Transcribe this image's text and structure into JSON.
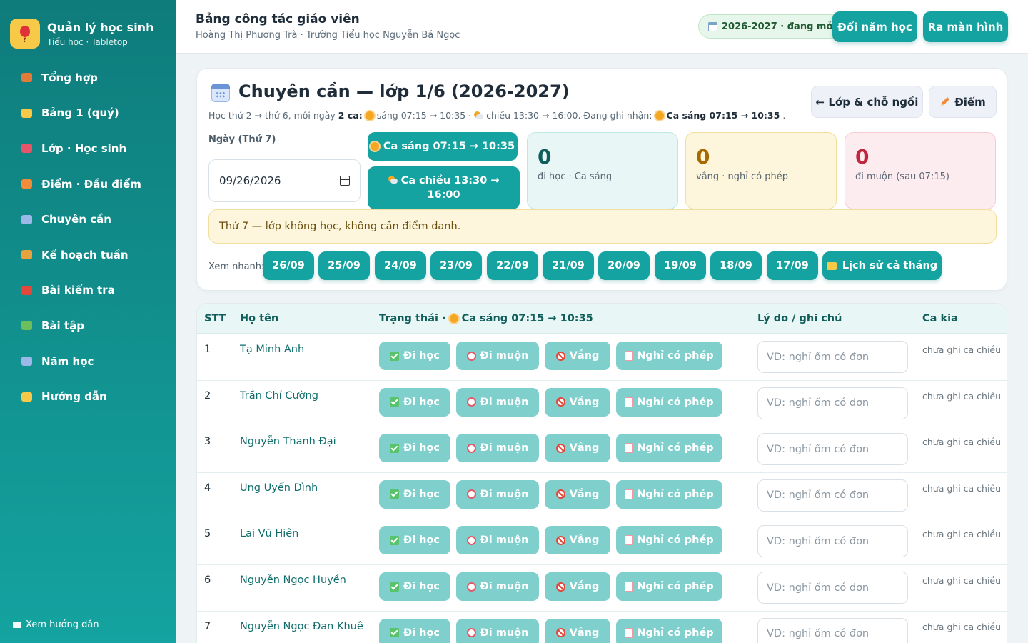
{
  "brand": {
    "title": "Quản lý học sinh",
    "subtitle": "Tiểu học · Tabletop"
  },
  "nav": [
    {
      "label": "Tổng hợp",
      "icon": "house-icon",
      "color": "#e07b39"
    },
    {
      "label": "Bảng 1 (quý)",
      "icon": "folder-icon",
      "color": "#f7c948"
    },
    {
      "label": "Lớp · Học sinh",
      "icon": "backpack-icon",
      "color": "#e8546a"
    },
    {
      "label": "Điểm · Đầu điểm",
      "icon": "pencil-icon",
      "color": "#f08c3a"
    },
    {
      "label": "Chuyên cần",
      "icon": "calendar-icon",
      "color": "#9bb8e8"
    },
    {
      "label": "Kế hoạch tuần",
      "icon": "compass-icon",
      "color": "#e6a23c"
    },
    {
      "label": "Bài kiểm tra",
      "icon": "target-icon",
      "color": "#e0483b"
    },
    {
      "label": "Bài tập",
      "icon": "books-icon",
      "color": "#6cbf5b"
    },
    {
      "label": "Năm học",
      "icon": "calendar-icon",
      "color": "#9bb8e8"
    },
    {
      "label": "Hướng dẫn",
      "icon": "bulb-icon",
      "color": "#f7c948"
    }
  ],
  "sidebar_footer": "Xem hướng dẫn",
  "header": {
    "title": "Bảng công tác giáo viên",
    "subtitle": "Hoàng Thị Phương Trà · Trường Tiểu học Nguyễn Bá Ngọc",
    "year_status": "2026-2027 · đang mở",
    "change_year": "Đổi năm học",
    "present": "Ra màn hình"
  },
  "attendance": {
    "title": "Chuyên cần — lớp 1/6 (2026-2027)",
    "desc_prefix": "Học thứ 2 → thứ 6, mỗi ngày",
    "desc_count": "2 ca:",
    "desc_morning": "sáng 07:15 → 10:35 ·",
    "desc_afternoon": "chiều 13:30 → 16:00. Đang ghi nhận:",
    "desc_current": "Ca sáng 07:15 → 10:35",
    "desc_end": ".",
    "back_button": "← Lớp & chỗ ngồi",
    "grades_button": "Điểm",
    "date_label": "Ngày (Thứ 7)",
    "date_value": "09/26/2026",
    "shift_morning": "Ca sáng 07:15 → 10:35",
    "shift_afternoon": "Ca chiều 13:30 → 16:00",
    "stats": [
      {
        "value": "0",
        "label": "đi học · Ca sáng",
        "bg": "#e8f7f6",
        "border": "#bfe6e3",
        "color": "#0f5e5c"
      },
      {
        "value": "0",
        "label": "vắng · nghỉ có phép",
        "bg": "#fdf6dc",
        "border": "#f0df9e",
        "color": "#a86a00"
      },
      {
        "value": "0",
        "label": "đi muộn (sau 07:15)",
        "bg": "#fdecef",
        "border": "#f7cbd3",
        "color": "#c0263d"
      }
    ],
    "notice": "Thứ 7 — lớp không học, không cần điểm danh.",
    "quick_label": "Xem nhanh:",
    "quick_dates": [
      "26/09",
      "25/09",
      "24/09",
      "23/09",
      "22/09",
      "21/09",
      "20/09",
      "19/09",
      "18/09",
      "17/09"
    ],
    "month_history": "Lịch sử cả tháng"
  },
  "table": {
    "headers": {
      "stt": "STT",
      "name": "Họ tên",
      "status": "Trạng thái ·",
      "status_shift": "Ca sáng 07:15 → 10:35",
      "note": "Lý do / ghi chú",
      "other": "Ca kia"
    },
    "actions": [
      "Đi học",
      "Đi muộn",
      "Vắng",
      "Nghỉ có phép"
    ],
    "note_placeholder": "VD: nghỉ ốm có đơn",
    "rows": [
      {
        "stt": "1",
        "name": "Tạ Minh Anh",
        "other": "chưa ghi ca chiều"
      },
      {
        "stt": "2",
        "name": "Trần Chí Cường",
        "other": "chưa ghi ca chiều"
      },
      {
        "stt": "3",
        "name": "Nguyễn Thanh Đại",
        "other": "chưa ghi ca chiều"
      },
      {
        "stt": "4",
        "name": "Ung Uyển Đình",
        "other": "chưa ghi ca chiều"
      },
      {
        "stt": "5",
        "name": "Lai Vũ Hiên",
        "other": "chưa ghi ca chiều"
      },
      {
        "stt": "6",
        "name": "Nguyễn Ngọc Huyền",
        "other": "chưa ghi ca chiều"
      },
      {
        "stt": "7",
        "name": "Nguyễn Ngọc Đan Khuê",
        "other": "chưa ghi ca chiều"
      }
    ]
  }
}
